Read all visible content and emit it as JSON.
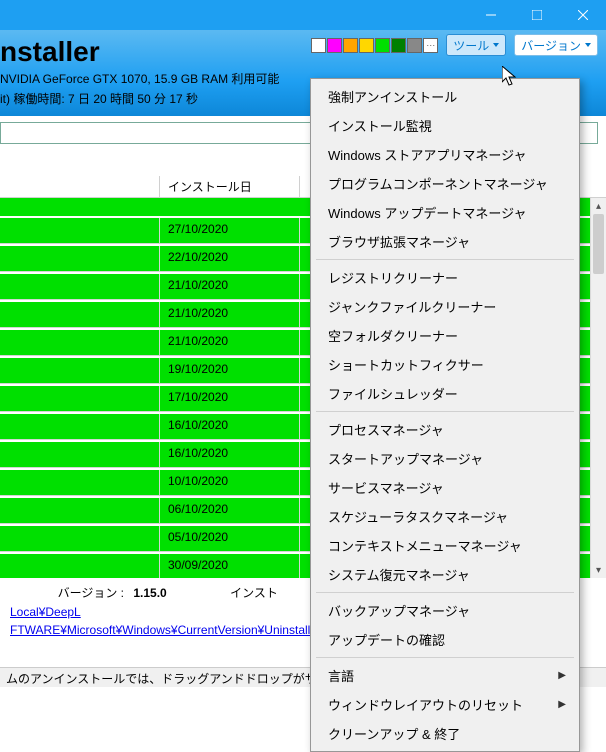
{
  "window": {
    "title_visible": "nstaller",
    "controls": {
      "min": "–",
      "max": "☐",
      "close": "✕"
    }
  },
  "header": {
    "sysinfo_line1": "NVIDIA GeForce GTX 1070, 15.9 GB RAM 利用可能",
    "sysinfo_line2_prefix": "it)  稼働時間: ",
    "uptime": "7 日 20 時間 50 分 17 秒"
  },
  "top_buttons": {
    "tools": "ツール",
    "version": "バージョン"
  },
  "swatch_colors": [
    "#ffffff",
    "#ff00ff",
    "#ffa500",
    "#ffd700",
    "#00e000",
    "#008000",
    "#888888"
  ],
  "columns": {
    "name": "",
    "install_date": "インストール日"
  },
  "rows": [
    {
      "date": "27/10/2020"
    },
    {
      "date": "22/10/2020"
    },
    {
      "date": "21/10/2020"
    },
    {
      "date": "21/10/2020"
    },
    {
      "date": "21/10/2020"
    },
    {
      "date": "19/10/2020"
    },
    {
      "date": "17/10/2020"
    },
    {
      "date": "16/10/2020"
    },
    {
      "date": "16/10/2020"
    },
    {
      "date": "10/10/2020"
    },
    {
      "date": "06/10/2020"
    },
    {
      "date": "05/10/2020"
    },
    {
      "date": "30/09/2020"
    }
  ],
  "detail": {
    "version_label": "バージョン :",
    "version_value": "1.15.0",
    "install_label_partial": "インスト",
    "path1": "Local¥DeepL",
    "path2": "FTWARE¥Microsoft¥Windows¥CurrentVersion¥Uninstall¥DeepL"
  },
  "statusbar": {
    "text": "ムのアンインストールでは、ドラッグアンドドロップがサポートされています。"
  },
  "tools_menu": {
    "groups": [
      [
        "強制アンインストール",
        "インストール監視",
        "Windows ストアアプリマネージャ",
        "プログラムコンポーネントマネージャ",
        "Windows アップデートマネージャ",
        "ブラウザ拡張マネージャ"
      ],
      [
        "レジストリクリーナー",
        "ジャンクファイルクリーナー",
        "空フォルダクリーナー",
        "ショートカットフィクサー",
        "ファイルシュレッダー"
      ],
      [
        "プロセスマネージャ",
        "スタートアップマネージャ",
        "サービスマネージャ",
        "スケジューラタスクマネージャ",
        "コンテキストメニューマネージャ",
        "システム復元マネージャ"
      ],
      [
        "バックアップマネージャ",
        "アップデートの確認"
      ]
    ],
    "submenu_items": [
      "言語",
      "ウィンドウレイアウトのリセット"
    ],
    "last": "クリーンアップ & 終了"
  }
}
